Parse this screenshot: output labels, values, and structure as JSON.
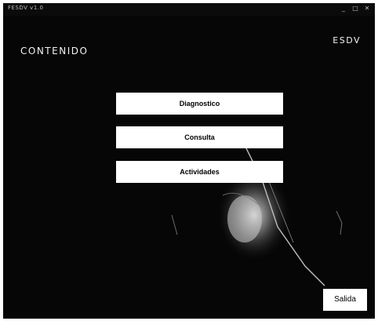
{
  "window": {
    "title": "FESDV v1.0",
    "controls": [
      "_",
      "□",
      "✕"
    ]
  },
  "header": {
    "title": "CONTENIDO",
    "app_code": "ESDV"
  },
  "menu": {
    "items": [
      {
        "label": "Diagnostico"
      },
      {
        "label": "Consulta"
      },
      {
        "label": "Actividades"
      }
    ]
  },
  "footer": {
    "exit_label": "Salida"
  },
  "colors": {
    "background": "#060606",
    "button": "#ffffff",
    "text": "#f2f2f2"
  }
}
